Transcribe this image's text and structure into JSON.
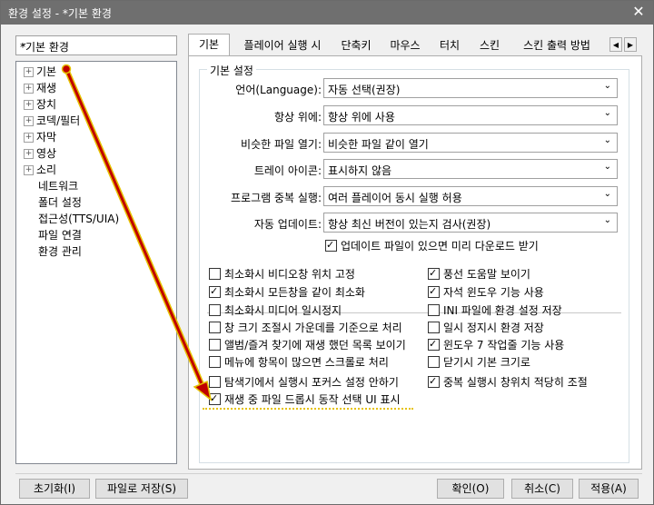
{
  "window": {
    "title": "환경 설정 - *기본 환경",
    "close_glyph": "✕"
  },
  "profile": {
    "value": "*기본 환경"
  },
  "tree": [
    {
      "label": "기본",
      "expander": "⊞"
    },
    {
      "label": "재생",
      "expander": "⊞"
    },
    {
      "label": "장치",
      "expander": "⊞"
    },
    {
      "label": "코덱/필터",
      "expander": "⊞"
    },
    {
      "label": "자막",
      "expander": "⊞"
    },
    {
      "label": "영상",
      "expander": "⊞"
    },
    {
      "label": "소리",
      "expander": "⊞"
    },
    {
      "label": "네트워크"
    },
    {
      "label": "폴더 설정"
    },
    {
      "label": "접근성(TTS/UIA)"
    },
    {
      "label": "파일 연결"
    },
    {
      "label": "환경 관리"
    }
  ],
  "tabs": [
    {
      "label": "기본"
    },
    {
      "label": "플레이어 실행 시"
    },
    {
      "label": "단축키"
    },
    {
      "label": "마우스"
    },
    {
      "label": "터치"
    },
    {
      "label": "스킨"
    },
    {
      "label": "스킨 출력 방법"
    }
  ],
  "basic_settings": {
    "group_title": "기본 설정",
    "rows": [
      {
        "label": "언어(Language):",
        "value": "자동 선택(권장)"
      },
      {
        "label": "항상 위에:",
        "value": "항상 위에 사용"
      },
      {
        "label": "비슷한 파일 열기:",
        "value": "비슷한 파일 같이 열기"
      },
      {
        "label": "트레이 아이콘:",
        "value": "표시하지 않음"
      },
      {
        "label": "프로그램 중복 실행:",
        "value": "여러 플레이어 동시 실행 허용"
      },
      {
        "label": "자동 업데이트:",
        "value": "항상 최신 버전이 있는지 검사(권장)"
      }
    ],
    "update_download": {
      "label": "업데이트 파일이 있으면 미리 다운로드 받기",
      "checked": true
    }
  },
  "options_left": [
    {
      "label": "최소화시 비디오창 위치 고정",
      "checked": false
    },
    {
      "label": "최소화시 모든창을 같이 최소화",
      "checked": true
    },
    {
      "label": "최소화시 미디어 일시정지",
      "checked": false
    },
    {
      "label": "창 크기 조절시 가운데를 기준으로 처리",
      "checked": false
    },
    {
      "label": "앨범/즐겨 찾기에 재생 했던 목록 보이기",
      "checked": false
    },
    {
      "label": "메뉴에 항목이 많으면 스크롤로 처리",
      "checked": false
    },
    {
      "label": "탐색기에서 실행시 포커스 설정 안하기",
      "checked": false
    },
    {
      "label": "재생 중 파일 드롭시 동작 선택 UI 표시",
      "checked": true
    }
  ],
  "options_right": [
    {
      "label": "풍선 도움말 보이기",
      "checked": true
    },
    {
      "label": "자석 윈도우 기능 사용",
      "checked": true
    },
    {
      "label": "INI 파일에 환경 설정 저장",
      "checked": false
    },
    {
      "label": "일시 정지시 환경 저장",
      "checked": false
    },
    {
      "label": "윈도우 7 작업줄 기능 사용",
      "checked": true
    },
    {
      "label": "닫기시 기본 크기로",
      "checked": false
    },
    {
      "label": "중복 실행시 창위치 적당히 조절",
      "checked": true
    }
  ],
  "footer": {
    "reset": "초기화(I)",
    "save_file": "파일로 저장(S)",
    "ok": "확인(O)",
    "cancel": "취소(C)",
    "apply": "적용(A)"
  },
  "glyphs": {
    "dropdown": "⌄",
    "scroll_left": "◀",
    "scroll_right": "▶"
  },
  "colors": {
    "titlebar": "#6f6f6f",
    "annotation_arrow": "#c00000",
    "annotation_arrow_outline": "#e6c200"
  }
}
